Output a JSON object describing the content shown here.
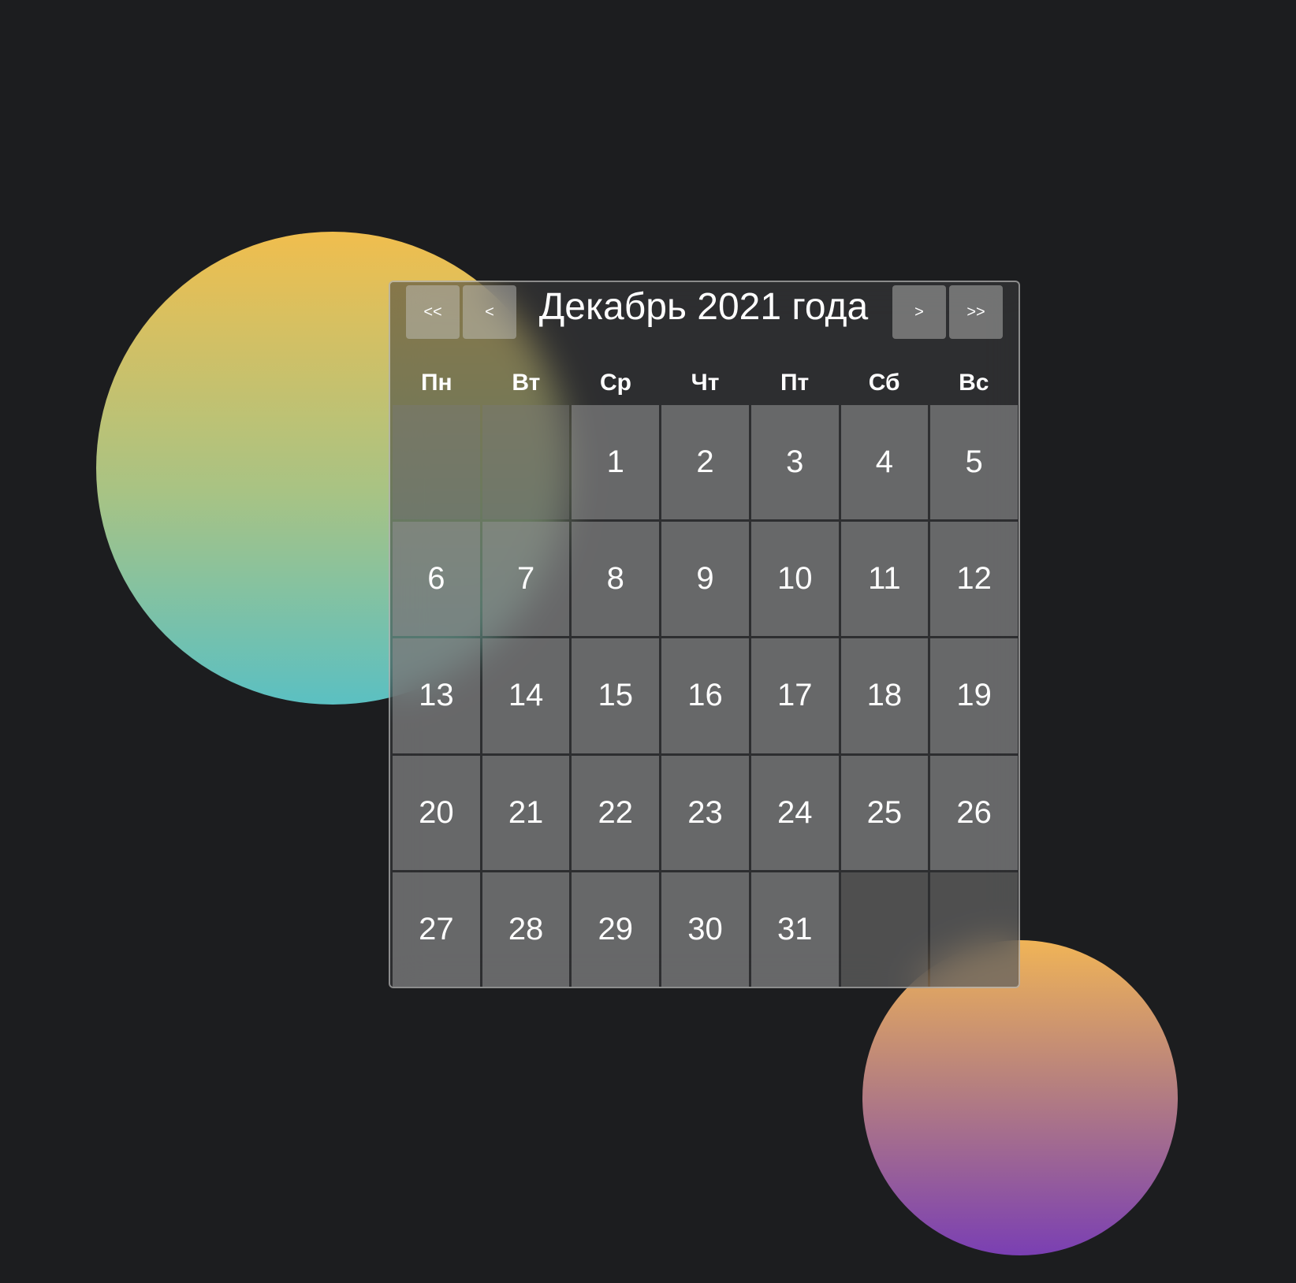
{
  "calendar": {
    "title": "Декабрь 2021 года",
    "nav": {
      "prev_year": "<<",
      "prev_month": "<",
      "next_month": ">",
      "next_year": ">>"
    },
    "weekdays": [
      "Пн",
      "Вт",
      "Ср",
      "Чт",
      "Пт",
      "Сб",
      "Вс"
    ],
    "weeks": [
      [
        "",
        "",
        "1",
        "2",
        "3",
        "4",
        "5"
      ],
      [
        "6",
        "7",
        "8",
        "9",
        "10",
        "11",
        "12"
      ],
      [
        "13",
        "14",
        "15",
        "16",
        "17",
        "18",
        "19"
      ],
      [
        "20",
        "21",
        "22",
        "23",
        "24",
        "25",
        "26"
      ],
      [
        "27",
        "28",
        "29",
        "30",
        "31",
        "",
        ""
      ]
    ]
  },
  "colors": {
    "background": "#1c1d1f",
    "blob_a_top": "#f0be4e",
    "blob_a_bottom": "#5bc0c2",
    "blob_b_top": "#f0b457",
    "blob_b_bottom": "#7a3fb3"
  }
}
